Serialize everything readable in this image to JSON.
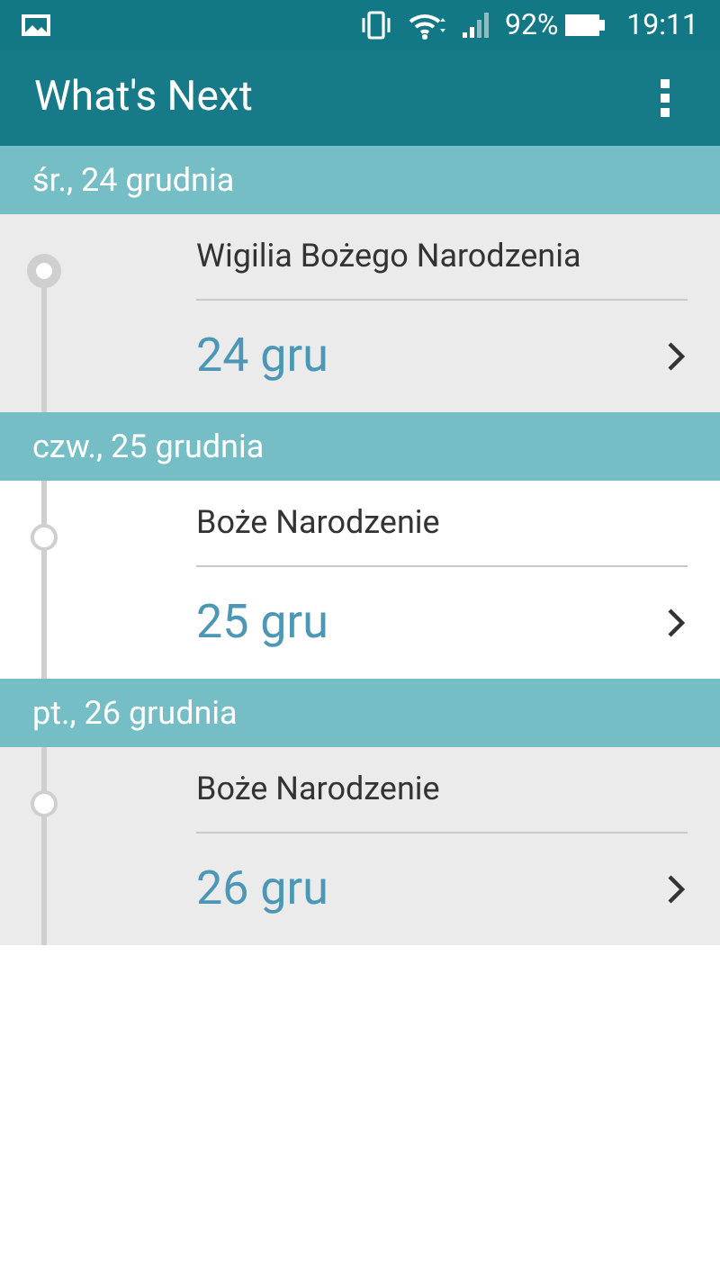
{
  "status_bar": {
    "battery": "92%",
    "time": "19:11"
  },
  "app_bar": {
    "title": "What's Next"
  },
  "days": [
    {
      "header": "śr., 24 grudnia",
      "event": {
        "title": "Wigilia Bożego Narodzenia",
        "date": "24 gru",
        "current": true
      }
    },
    {
      "header": "czw., 25 grudnia",
      "event": {
        "title": "Boże Narodzenie",
        "date": "25 gru",
        "current": false
      }
    },
    {
      "header": "pt., 26 grudnia",
      "event": {
        "title": "Boże Narodzenie",
        "date": "26 gru",
        "current": false
      }
    }
  ]
}
